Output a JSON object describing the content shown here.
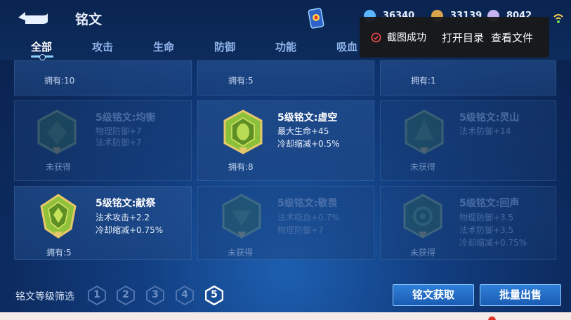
{
  "header": {
    "title": "铭文",
    "resources": [
      {
        "value": "36340",
        "color": "#5ab6ff",
        "icon": "diamond-icon"
      },
      {
        "value": "33139",
        "color": "#d8a34a",
        "icon": "gold-coin-icon"
      },
      {
        "value": "8042",
        "color": "#c7b4f0",
        "icon": "crystal-icon"
      }
    ]
  },
  "tabs": [
    {
      "label": "全部",
      "active": true
    },
    {
      "label": "攻击"
    },
    {
      "label": "生命"
    },
    {
      "label": "防御"
    },
    {
      "label": "功能"
    },
    {
      "label": "吸血"
    }
  ],
  "toast": {
    "message": "截图成功",
    "open_folder": "打开目录",
    "view_file": "查看文件"
  },
  "top_row": [
    {
      "owned": "拥有:10"
    },
    {
      "owned": "拥有:5"
    },
    {
      "owned": "拥有:1"
    }
  ],
  "rows": [
    [
      {
        "name": "5级铭文:均衡",
        "stats": [
          "物理防御+7",
          "法术防御+7"
        ],
        "status": "未获得",
        "owned": false,
        "color": "#3c7a4a"
      },
      {
        "name": "5级铭文:虚空",
        "stats": [
          "最大生命+45",
          "冷却缩减+0.5%"
        ],
        "status": "拥有:8",
        "owned": true,
        "color": "#6fae2c"
      },
      {
        "name": "5级铭文:灵山",
        "stats": [
          "法术防御+14"
        ],
        "status": "未获得",
        "owned": false,
        "color": "#3c7a4a"
      }
    ],
    [
      {
        "name": "5级铭文:献祭",
        "stats": [
          "法术攻击+2.2",
          "冷却缩减+0.75%"
        ],
        "status": "拥有:5",
        "owned": true,
        "color": "#7cb52a"
      },
      {
        "name": "5级铭文:敬畏",
        "stats": [
          "法术吸血+0.7%",
          "物理防御+7"
        ],
        "status": "未获得",
        "owned": false,
        "color": "#3c7a4a"
      },
      {
        "name": "5级铭文:回声",
        "stats": [
          "物理防御+3.5",
          "法术防御+3.5",
          "冷却缩减+0.75%"
        ],
        "status": "未获得",
        "owned": false,
        "color": "#3c7a4a"
      }
    ]
  ],
  "bottom": {
    "filter_label": "铭文等级筛选",
    "levels": [
      "1",
      "2",
      "3",
      "4",
      "5"
    ],
    "active_level": "5",
    "acquire_button": "铭文获取",
    "bulk_sell_button": "批量出售"
  }
}
